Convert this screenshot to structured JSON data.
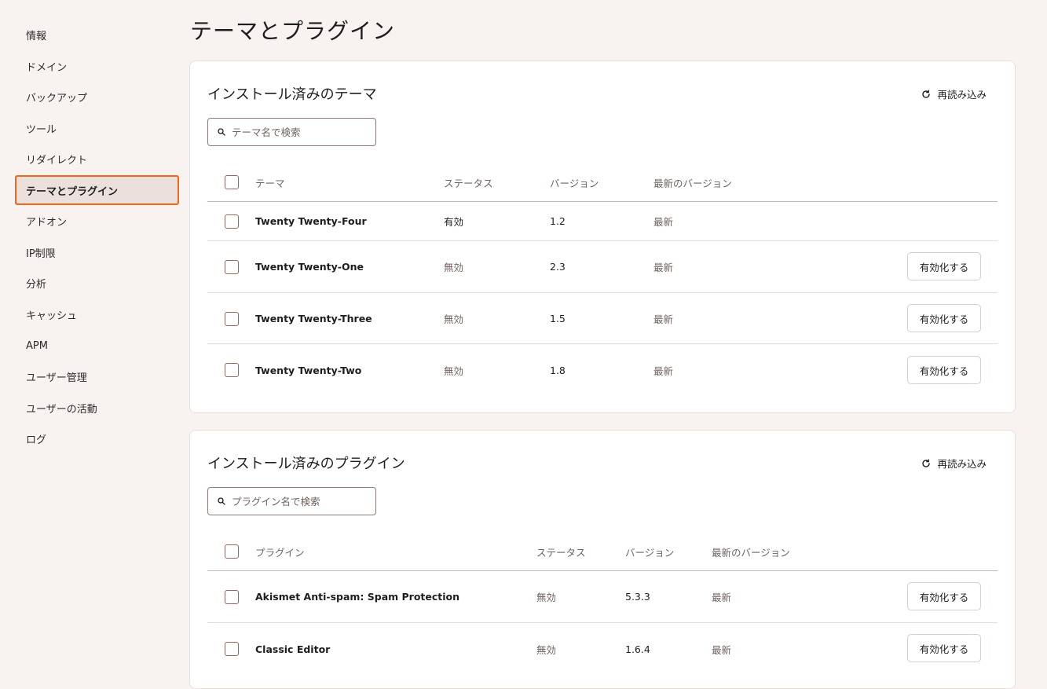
{
  "sidebar": {
    "items": [
      {
        "label": "情報",
        "active": false
      },
      {
        "label": "ドメイン",
        "active": false
      },
      {
        "label": "バックアップ",
        "active": false
      },
      {
        "label": "ツール",
        "active": false
      },
      {
        "label": "リダイレクト",
        "active": false
      },
      {
        "label": "テーマとプラグイン",
        "active": true
      },
      {
        "label": "アドオン",
        "active": false
      },
      {
        "label": "IP制限",
        "active": false
      },
      {
        "label": "分析",
        "active": false
      },
      {
        "label": "キャッシュ",
        "active": false
      },
      {
        "label": "APM",
        "active": false
      },
      {
        "label": "ユーザー管理",
        "active": false
      },
      {
        "label": "ユーザーの活動",
        "active": false
      },
      {
        "label": "ログ",
        "active": false
      }
    ]
  },
  "page": {
    "title": "テーマとプラグイン"
  },
  "colors": {
    "accent_outline": "#f2661e",
    "active_bg": "#ece0dc",
    "page_bg": "#f8f3f0"
  },
  "themes": {
    "title": "インストール済みのテーマ",
    "refresh_label": "再読み込み",
    "search_placeholder": "テーマ名で検索",
    "columns": {
      "name": "テーマ",
      "status": "ステータス",
      "version": "バージョン",
      "latest": "最新のバージョン"
    },
    "rows": [
      {
        "name": "Twenty Twenty-Four",
        "status": "有効",
        "version": "1.2",
        "latest": "最新",
        "action": ""
      },
      {
        "name": "Twenty Twenty-One",
        "status": "無効",
        "version": "2.3",
        "latest": "最新",
        "action": "有効化する"
      },
      {
        "name": "Twenty Twenty-Three",
        "status": "無効",
        "version": "1.5",
        "latest": "最新",
        "action": "有効化する"
      },
      {
        "name": "Twenty Twenty-Two",
        "status": "無効",
        "version": "1.8",
        "latest": "最新",
        "action": "有効化する"
      }
    ]
  },
  "plugins": {
    "title": "インストール済みのプラグイン",
    "refresh_label": "再読み込み",
    "search_placeholder": "プラグイン名で検索",
    "columns": {
      "name": "プラグイン",
      "status": "ステータス",
      "version": "バージョン",
      "latest": "最新のバージョン"
    },
    "rows": [
      {
        "name": "Akismet Anti-spam: Spam Protection",
        "status": "無効",
        "version": "5.3.3",
        "latest": "最新",
        "action": "有効化する"
      },
      {
        "name": "Classic Editor",
        "status": "無効",
        "version": "1.6.4",
        "latest": "最新",
        "action": "有効化する"
      }
    ]
  }
}
